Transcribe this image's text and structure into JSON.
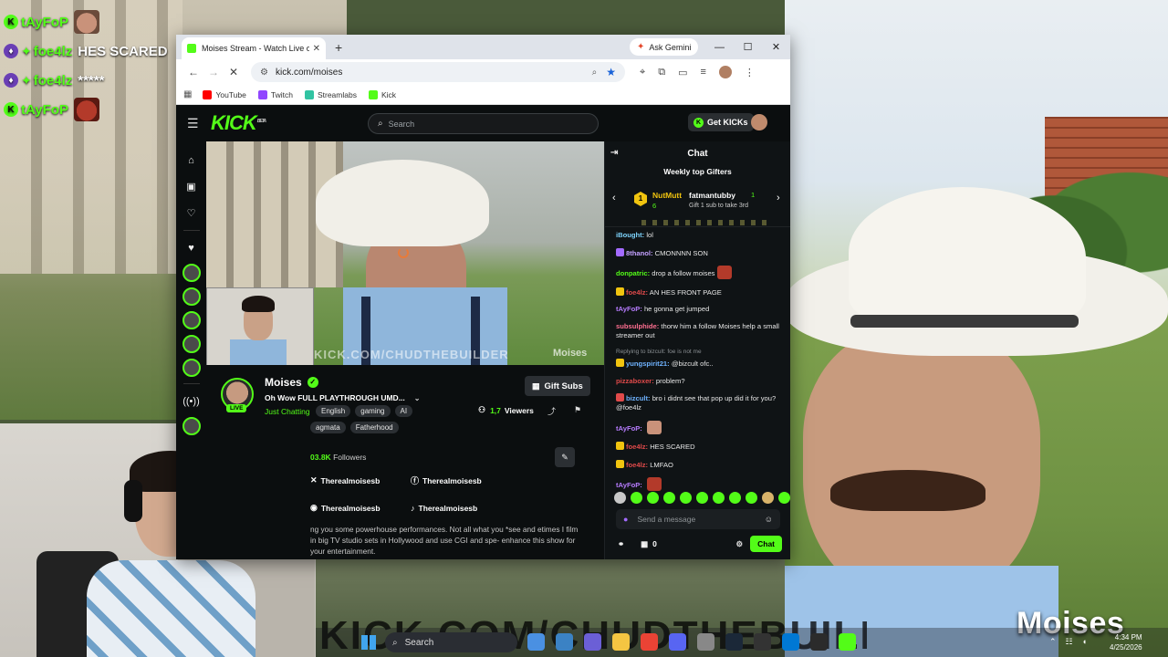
{
  "stream_chat_overlay": [
    {
      "user": "tAyFoP",
      "text": "",
      "user_color": "#53fc18",
      "emote": "face1"
    },
    {
      "user": "foe4lz",
      "text": "HES SCARED",
      "user_color": "#53fc18",
      "emote": ""
    },
    {
      "user": "foe4lz",
      "text": "*****",
      "user_color": "#53fc18",
      "emote": ""
    },
    {
      "user": "tAyFoP",
      "text": "",
      "user_color": "#53fc18",
      "emote": "face2"
    }
  ],
  "overlay": {
    "streamer_name": "Moises",
    "url_text": "KICK.COM/CHUDTHEBUILDER"
  },
  "browser": {
    "tab_title": "Moises Stream - Watch Live on Kick",
    "ask_gemini": "Ask Gemini",
    "url": "kick.com/moises",
    "bookmarks": [
      {
        "label": "YouTube",
        "color": "#ff0000"
      },
      {
        "label": "Twitch",
        "color": "#9146ff"
      },
      {
        "label": "Streamlabs",
        "color": "#31c3a2"
      },
      {
        "label": "Kick",
        "color": "#53fc18"
      }
    ]
  },
  "kick": {
    "logo": "KICK",
    "beta": "BETA",
    "search_placeholder": "Search",
    "get_kicks": "Get KICKs",
    "player": {
      "url_watermark": "KICK.COM/CHUDTHEBUILDER",
      "name_watermark": "Moises"
    },
    "channel": {
      "name": "Moises",
      "live": "LIVE",
      "title": "Oh Wow FULL PLAYTHROUGH UMD...",
      "category": "Just Chatting",
      "tags": [
        "English",
        "gaming",
        "AI"
      ],
      "tags2": [
        "agmata",
        "Fatherhood"
      ],
      "gift_subs": "Gift Subs",
      "viewers": "1,7",
      "viewers_label": "Viewers",
      "followers_count": "03.8K",
      "followers_label": "Followers",
      "socials": [
        "Therealmoisesb",
        "Therealmoisesb",
        "Therealmoisesb",
        "Therealmoisesb"
      ],
      "bio": "ng you some powerhouse performances. Not all what you *see and etimes I film in big TV studio sets in Hollywood and use CGI and spe- enhance this show for your entertainment."
    },
    "chat": {
      "header": "Chat",
      "gifters_title": "Weekly top Gifters",
      "gifter1_rank": "1",
      "gifter1_name": "NutMutt",
      "gifter1_count": "6",
      "gifter2_name": "fatmantubby",
      "gifter2_count": "1",
      "gifter_cta": "Gift 1 sub to take 3rd",
      "messages": [
        {
          "user": "iBought:",
          "color": "#7dd3fc",
          "text": "lol",
          "reply": "",
          "badge": "",
          "emote": ""
        },
        {
          "user": "8thanol:",
          "color": "#c4a1ff",
          "text": "CMONNNN SON",
          "reply": "",
          "badge": "#a36bff",
          "emote": ""
        },
        {
          "user": "donpatric:",
          "color": "#53fc18",
          "text": "drop a follow moises",
          "reply": "",
          "badge": "",
          "emote": "#b33a2a"
        },
        {
          "user": "foe4lz:",
          "color": "#e04a4a",
          "text": "AN HES FRONT PAGE",
          "reply": "",
          "badge": "#f1c40f",
          "emote": ""
        },
        {
          "user": "tAyFoP:",
          "color": "#b77cff",
          "text": "he gonna get jumped",
          "reply": "",
          "badge": "",
          "emote": ""
        },
        {
          "user": "subsulphide:",
          "color": "#ff6f91",
          "text": "thorw him a follow Moises help a small streamer out",
          "reply": "",
          "badge": "",
          "emote": ""
        },
        {
          "user": "yungspirit21:",
          "color": "#6fb3ff",
          "text": "@bizcult ofc..",
          "reply": "Replying to bizcult: foe is not me",
          "badge": "#f1c40f",
          "emote": ""
        },
        {
          "user": "pizzaboxer:",
          "color": "#e04a4a",
          "text": "problem?",
          "reply": "",
          "badge": "",
          "emote": ""
        },
        {
          "user": "bizcult:",
          "color": "#6fb3ff",
          "text": "bro i didnt see that pop up did it for you? @foe4lz",
          "reply": "",
          "badge": "#e04a4a",
          "emote": ""
        },
        {
          "user": "tAyFoP:",
          "color": "#b77cff",
          "text": "",
          "reply": "",
          "badge": "",
          "emote": "#c9927a"
        },
        {
          "user": "foe4lz:",
          "color": "#e04a4a",
          "text": "HES SCARED",
          "reply": "",
          "badge": "#f1c40f",
          "emote": ""
        },
        {
          "user": "foe4lz:",
          "color": "#e04a4a",
          "text": "LMFAO",
          "reply": "",
          "badge": "#f1c40f",
          "emote": ""
        },
        {
          "user": "tAyFoP:",
          "color": "#b77cff",
          "text": "",
          "reply": "",
          "badge": "",
          "emote": "#b33a2a"
        }
      ],
      "send_placeholder": "Send a message",
      "points": "0",
      "chat_button": "Chat"
    }
  },
  "taskbar": {
    "search": "Search",
    "apps": [
      "#4a90e2",
      "#3b82c4",
      "#6b5fd6",
      "#f4c542",
      "#ea4335",
      "#5865f2",
      "#888888",
      "#1b2838",
      "#333333",
      "#0078d4",
      "#2b2b2b",
      "#53fc18"
    ],
    "time": "4:34 PM",
    "date": "4/25/2026"
  }
}
